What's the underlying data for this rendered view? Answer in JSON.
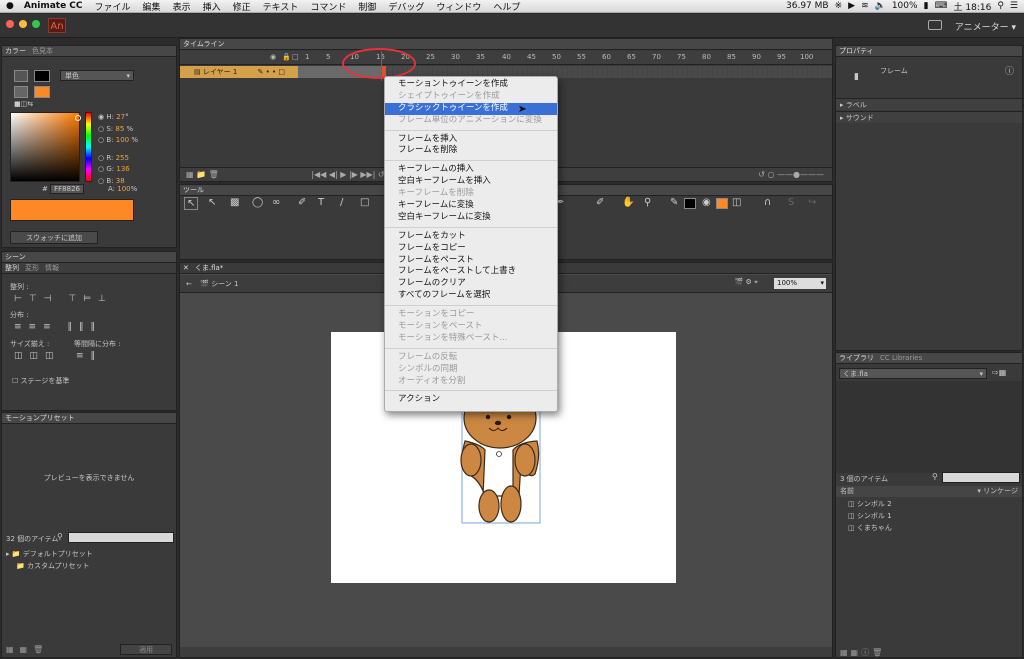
{
  "menubar": {
    "apple": "",
    "app": "Animate CC",
    "items": [
      "ファイル",
      "編集",
      "表示",
      "挿入",
      "修正",
      "テキスト",
      "コマンド",
      "制御",
      "デバッグ",
      "ウィンドウ",
      "ヘルプ"
    ],
    "memory": "36.97 MB",
    "battery": "100%",
    "clock": "土 18:16"
  },
  "titlebar": {
    "logo": "An",
    "workspace": "アニメーター ▾"
  },
  "color_panel": {
    "tabs": [
      "カラー",
      "色見本"
    ],
    "fill_type": "単色",
    "h_label": "H:",
    "h": "27",
    "h_unit": "°",
    "s_label": "S:",
    "s": "85",
    "s_unit": "%",
    "b_label": "B:",
    "b": "100",
    "b_unit": "%",
    "r_label": "R:",
    "r": "255",
    "g_label": "G:",
    "g": "136",
    "bl_label": "B:",
    "bl": "38",
    "hash": "#",
    "hex": "FF8826",
    "a_label": "A:",
    "a": "100",
    "a_unit": "%",
    "add_swatch": "スウォッチに追加",
    "fill_color": "#FF8826"
  },
  "scene_panel": {
    "tab": "シーン",
    "subtabs": [
      "整列",
      "変形",
      "情報"
    ],
    "align_label": "整列 :",
    "distribute_label": "分布 :",
    "size_label": "サイズ揃え :",
    "spacing_label": "等間隔に分布 :",
    "stage_checkbox": "ステージを基準"
  },
  "motion_presets": {
    "title": "モーションプリセット",
    "preview": "プレビューを表示できません",
    "count": "32 個のアイテム",
    "folders": [
      "デフォルトプリセット",
      "カスタムプリセット"
    ],
    "apply": "適用"
  },
  "timeline": {
    "title": "タイムライン",
    "layer": "レイヤー 1",
    "frames": [
      "1",
      "5",
      "10",
      "15",
      "20",
      "25",
      "30",
      "35",
      "40",
      "45",
      "50",
      "55",
      "60",
      "65",
      "70",
      "75",
      "80",
      "85",
      "90",
      "95",
      "100"
    ]
  },
  "tools": {
    "title": "ツール"
  },
  "document": {
    "tab": "くま.fla*",
    "scene": "シーン 1",
    "zoom": "100%"
  },
  "context_menu": {
    "groups": [
      [
        {
          "label": "モーショントゥイーンを作成",
          "enabled": true
        },
        {
          "label": "シェイプトゥイーンを作成",
          "enabled": false
        },
        {
          "label": "クラシックトゥイーンを作成",
          "enabled": true,
          "selected": true
        },
        {
          "label": "フレーム単位のアニメーションに変換",
          "enabled": false
        }
      ],
      [
        {
          "label": "フレームを挿入",
          "enabled": true
        },
        {
          "label": "フレームを削除",
          "enabled": true
        }
      ],
      [
        {
          "label": "キーフレームの挿入",
          "enabled": true
        },
        {
          "label": "空白キーフレームを挿入",
          "enabled": true
        },
        {
          "label": "キーフレームを削除",
          "enabled": false
        },
        {
          "label": "キーフレームに変換",
          "enabled": true
        },
        {
          "label": "空白キーフレームに変換",
          "enabled": true
        }
      ],
      [
        {
          "label": "フレームをカット",
          "enabled": true
        },
        {
          "label": "フレームをコピー",
          "enabled": true
        },
        {
          "label": "フレームをペースト",
          "enabled": true
        },
        {
          "label": "フレームをペーストして上書き",
          "enabled": true
        },
        {
          "label": "フレームのクリア",
          "enabled": true
        },
        {
          "label": "すべてのフレームを選択",
          "enabled": true
        }
      ],
      [
        {
          "label": "モーションをコピー",
          "enabled": false
        },
        {
          "label": "モーションをペースト",
          "enabled": false
        },
        {
          "label": "モーションを特殊ペースト...",
          "enabled": false
        }
      ],
      [
        {
          "label": "フレームの反転",
          "enabled": false
        },
        {
          "label": "シンボルの同期",
          "enabled": false
        },
        {
          "label": "オーディオを分割",
          "enabled": false
        }
      ],
      [
        {
          "label": "アクション",
          "enabled": true
        }
      ]
    ]
  },
  "properties": {
    "title": "プロパティ",
    "kind": "フレーム",
    "sections": [
      "ラベル",
      "サウンド"
    ]
  },
  "library": {
    "tabs": [
      "ライブラリ",
      "CC Libraries"
    ],
    "file": "くま.fla",
    "count": "3 個のアイテム",
    "col_name": "名前",
    "col_linkage": "リンケージ",
    "items": [
      "シンボル 2",
      "シンボル 1",
      "くまちゃん"
    ]
  },
  "colors": {
    "accent": "#3B6FD8",
    "fill": "#FF8826",
    "layer": "#D5A04A",
    "annotation": "#E8313A"
  }
}
